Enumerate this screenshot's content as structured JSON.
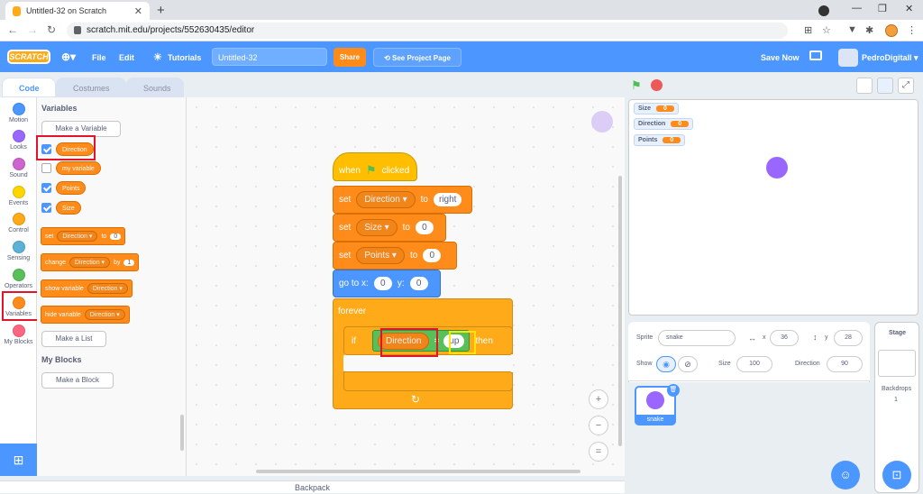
{
  "browser": {
    "tab_title": "Untitled-32 on Scratch",
    "new_tab": "+",
    "url": "scratch.mit.edu/projects/552630435/editor",
    "min": "—",
    "max": "❐",
    "close": "✕"
  },
  "menu": {
    "logo": "SCRATCH",
    "file": "File",
    "edit": "Edit",
    "tutorials": "Tutorials",
    "project_title": "Untitled-32",
    "share": "Share",
    "see_project": "See Project Page",
    "save_now": "Save Now",
    "username": "PedroDigitall"
  },
  "tabs": {
    "code": "Code",
    "costumes": "Costumes",
    "sounds": "Sounds"
  },
  "categories": [
    {
      "label": "Motion",
      "color": "#4c97ff"
    },
    {
      "label": "Looks",
      "color": "#9966ff"
    },
    {
      "label": "Sound",
      "color": "#cf63cf"
    },
    {
      "label": "Events",
      "color": "#ffd500"
    },
    {
      "label": "Control",
      "color": "#ffab19"
    },
    {
      "label": "Sensing",
      "color": "#5cb1d6"
    },
    {
      "label": "Operators",
      "color": "#59c059"
    },
    {
      "label": "Variables",
      "color": "#ff8c1a"
    },
    {
      "label": "My Blocks",
      "color": "#ff6680"
    }
  ],
  "palette": {
    "heading": "Variables",
    "make_variable": "Make a Variable",
    "vars": [
      "Direction",
      "my variable",
      "Points",
      "Size"
    ],
    "set": "set",
    "to": "to",
    "set_val": "0",
    "change": "change",
    "by": "by",
    "change_val": "1",
    "show_variable": "show variable",
    "hide_variable": "hide variable",
    "dd_var": "Direction",
    "make_list": "Make a List",
    "my_blocks": "My Blocks",
    "make_block": "Make a Block"
  },
  "script": {
    "when": "when",
    "clicked": "clicked",
    "set": "set",
    "to": "to",
    "var1": "Direction",
    "val1": "right",
    "var2": "Size",
    "val2": "0",
    "var3": "Points",
    "val3": "0",
    "goto": "go to x:",
    "x": "0",
    "y_label": "y:",
    "y": "0",
    "forever": "forever",
    "if": "if",
    "then": "then",
    "cond_var": "Direction",
    "eq": "=",
    "cond_val": "up",
    "loop": "↻"
  },
  "zoom": {
    "in": "+",
    "out": "−",
    "reset": "="
  },
  "backpack": "Backpack",
  "monitors": [
    {
      "label": "Size",
      "value": "0"
    },
    {
      "label": "Direction",
      "value": "0"
    },
    {
      "label": "Points",
      "value": "0"
    }
  ],
  "sprite_info": {
    "sprite_label": "Sprite",
    "sprite_name": "snake",
    "x_label": "x",
    "x": "36",
    "y_label": "y",
    "y": "28",
    "show_label": "Show",
    "size_label": "Size",
    "size": "100",
    "direction_label": "Direction",
    "direction": "90"
  },
  "sprite_card": "snake",
  "stage_pane": {
    "title": "Stage",
    "backdrops_label": "Backdrops",
    "backdrops_count": "1"
  }
}
